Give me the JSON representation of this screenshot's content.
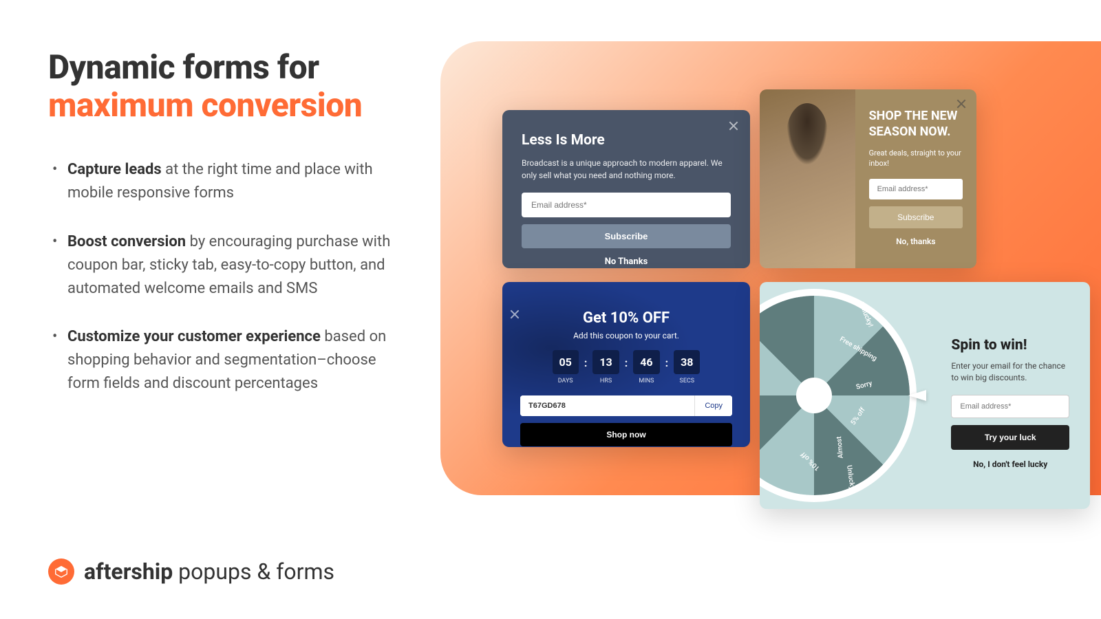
{
  "heading": {
    "line1": "Dynamic forms for",
    "line2": "maximum conversion"
  },
  "bullets": [
    {
      "strong": "Capture leads",
      "rest": " at the right time and place with mobile responsive forms"
    },
    {
      "strong": "Boost conversion",
      "rest": " by encouraging purchase with coupon bar, sticky tab, easy-to-copy button, and automated welcome emails and SMS"
    },
    {
      "strong": "Customize your customer experience",
      "rest": " based on shopping behavior and segmentation–choose form fields and discount percentages"
    }
  ],
  "brand": {
    "bold": "aftership",
    "light": " popups & forms"
  },
  "popup1": {
    "title": "Less Is More",
    "body": "Broadcast is a unique approach to modern apparel. We only sell what you need and nothing more.",
    "placeholder": "Email address*",
    "subscribe": "Subscribe",
    "no": "No Thanks"
  },
  "popup2": {
    "title": "SHOP THE NEW SEASON NOW.",
    "body": "Great deals, straight to your inbox!",
    "placeholder": "Email address*",
    "subscribe": "Subscribe",
    "no": "No, thanks"
  },
  "popup3": {
    "title": "Get 10% OFF",
    "sub": "Add this coupon to your cart.",
    "timer": [
      {
        "val": "05",
        "label": "DAYS"
      },
      {
        "val": "13",
        "label": "HRS"
      },
      {
        "val": "46",
        "label": "MINS"
      },
      {
        "val": "38",
        "label": "SECS"
      }
    ],
    "code": "T67GD678",
    "copy": "Copy",
    "shop": "Shop now"
  },
  "popup4": {
    "title": "Spin to win!",
    "body": "Enter your email for the chance to win big discounts.",
    "placeholder": "Email address*",
    "luck": "Try your luck",
    "no": "No, I don't feel lucky",
    "segments": [
      "Unlucky!",
      "Free shipping",
      "Sorry",
      "5% off",
      "Almost",
      "10% off",
      "Unlucky!"
    ]
  }
}
